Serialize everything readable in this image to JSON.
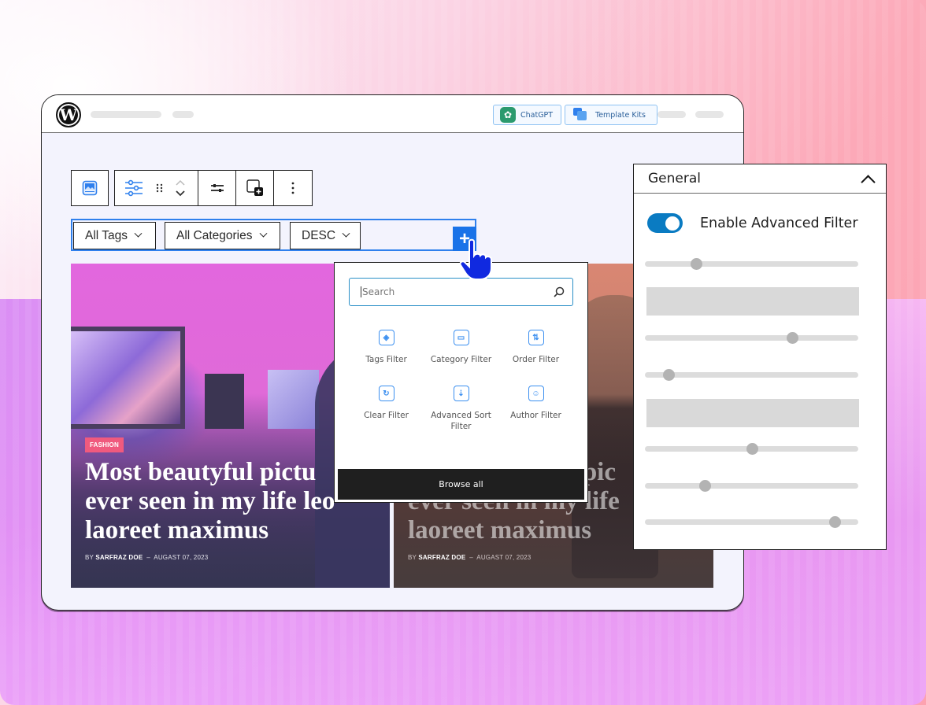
{
  "topbar": {
    "logo": "wordpress-logo",
    "buttons": [
      {
        "label": "ChatGPT",
        "icon": "chatgpt-icon",
        "icon_color": "#2b9a6e"
      },
      {
        "label": "Template Kits",
        "icon": "template-kits-icon",
        "icon_color": "#2f80ed"
      }
    ]
  },
  "block_toolbar": {
    "items": [
      {
        "name": "image-block-icon"
      },
      {
        "name": "filter-settings-icon"
      },
      {
        "name": "drag-handle-icon"
      },
      {
        "name": "move-up-down-icon"
      },
      {
        "name": "adjust-icon"
      },
      {
        "name": "insert-block-icon"
      },
      {
        "name": "more-options-icon"
      }
    ]
  },
  "filter_bar": {
    "selects": [
      {
        "value": "All Tags"
      },
      {
        "value": "All Categories"
      },
      {
        "value": "DESC"
      }
    ],
    "add_label": "+",
    "accent": "#1a73e8"
  },
  "posts": [
    {
      "category": "FASHION",
      "title": "Most beautyful pictu\never seen in my life leo\nlaoreet maximus",
      "by": "BY",
      "author": "SARFRAZ DOE",
      "separator": "–",
      "date": "AUGAST 07, 2023"
    },
    {
      "category": "",
      "title": "Most beautyful pic\never seen in my life\nlaoreet maximus",
      "by": "BY",
      "author": "SARFRAZ DOE",
      "separator": "–",
      "date": "AUGAST 07, 2023"
    }
  ],
  "inserter": {
    "search_placeholder": "Search",
    "items": [
      {
        "label": "Tags Filter",
        "icon": "tag-icon",
        "glyph": "◈"
      },
      {
        "label": "Category Filter",
        "icon": "folder-icon",
        "glyph": "▭"
      },
      {
        "label": "Order Filter",
        "icon": "sort-arrows-icon",
        "glyph": "⇅"
      },
      {
        "label": "Clear Filter",
        "icon": "refresh-icon",
        "glyph": "↻"
      },
      {
        "label": "Advanced Sort Filter",
        "icon": "advanced-sort-icon",
        "glyph": "⇣"
      },
      {
        "label": "Author Filter",
        "icon": "user-icon",
        "glyph": "☺"
      }
    ],
    "browse_all": "Browse all"
  },
  "panel": {
    "title": "General",
    "toggle_label": "Enable Advanced Filter",
    "toggle_on": true,
    "toggle_color": "#0a7bc2",
    "sliders": [
      0.24,
      0.69,
      0.11,
      0.5,
      0.28,
      0.89
    ]
  }
}
